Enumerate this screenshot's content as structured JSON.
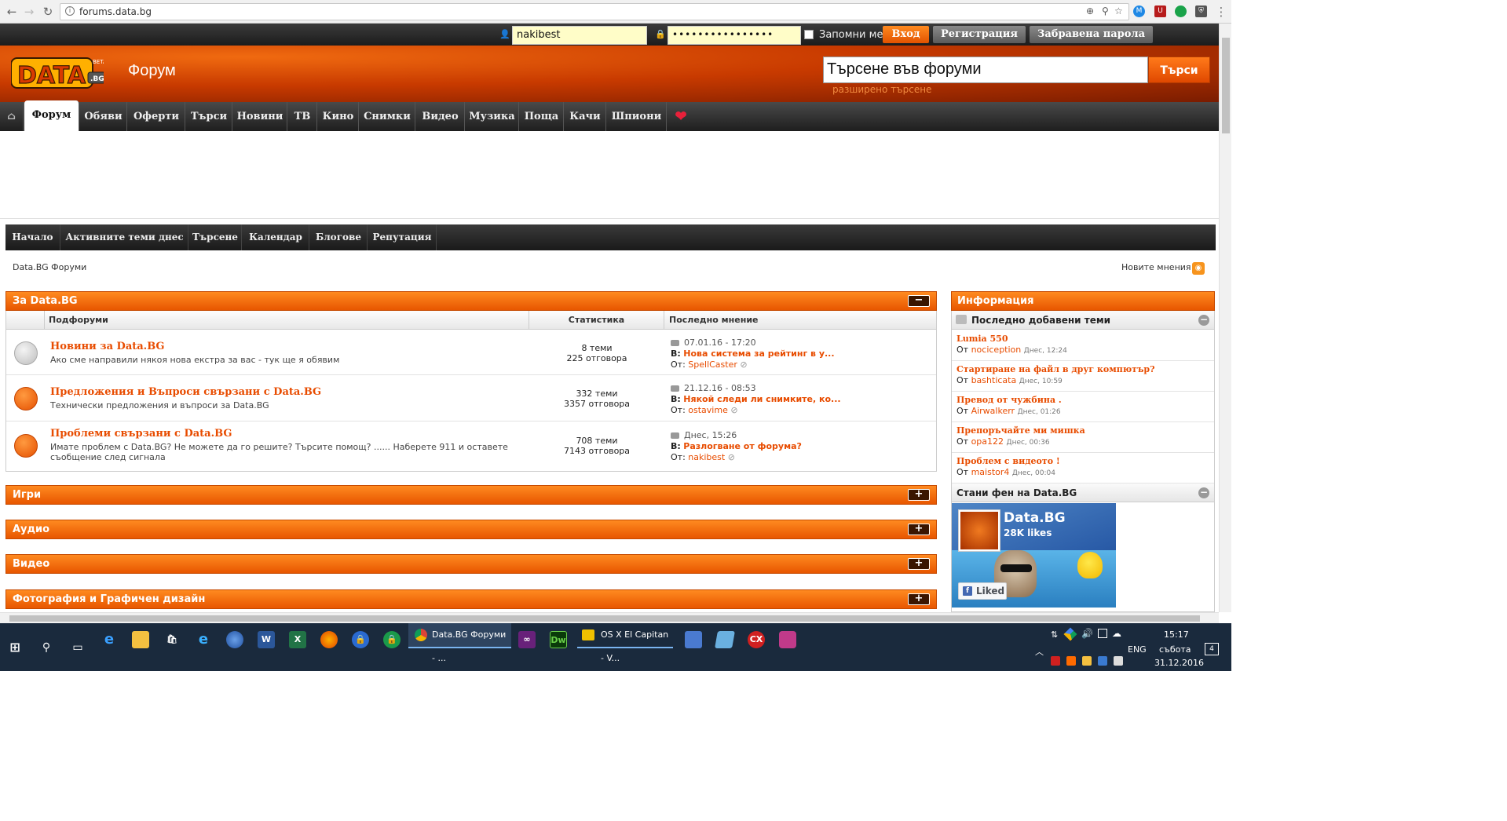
{
  "browser": {
    "url": "forums.data.bg"
  },
  "login": {
    "username": "nakibest",
    "password": "••••••••••••••••",
    "remember_label": "Запомни ме",
    "login_button": "Вход",
    "register_button": "Регистрация",
    "forgot_button": "Забравена парола"
  },
  "header": {
    "logo_text": "DATA",
    "logo_beta": "BETA",
    "logo_bg": ".BG",
    "title": "Форум",
    "search_value": "Търсене във форуми",
    "search_button": "Търси",
    "advanced_search": "разширено търсене"
  },
  "mainnav": {
    "items": [
      "Форум",
      "Обяви",
      "Оферти",
      "Търси",
      "Новини",
      "ТВ",
      "Кино",
      "Снимки",
      "Видео",
      "Музика",
      "Поща",
      "Качи",
      "Шпиони"
    ]
  },
  "subnav": {
    "items": [
      "Начало",
      "Активните теми днес",
      "Търсене",
      "Календар",
      "Блогове",
      "Репутация"
    ]
  },
  "breadcrumb": "Data.BG Форуми",
  "new_posts": "Новите мнения",
  "category": {
    "title": "За Data.BG",
    "col_subforums": "Подфоруми",
    "col_stats": "Статистика",
    "col_last": "Последно мнение",
    "forums": [
      {
        "title": "Новини за Data.BG",
        "desc": "Ако сме направили някоя нова екстра за вас - тук ще я обявим",
        "topics": "8 теми",
        "replies": "225 отговора",
        "date": "07.01.16 - 17:20",
        "prefix": "В:",
        "last_title": "Нова система за рейтинг в у...",
        "from": "От:",
        "user": "SpellCaster"
      },
      {
        "title": "Предложения и Въпроси свързани с Data.BG",
        "desc": "Технически предложения и въпроси за Data.BG",
        "topics": "332 теми",
        "replies": "3357 отговора",
        "date": "21.12.16 - 08:53",
        "prefix": "В:",
        "last_title": "Някой следи ли снимките, ко...",
        "from": "От:",
        "user": "ostavime"
      },
      {
        "title": "Проблеми свързани с Data.BG",
        "desc": "Имате проблем с Data.BG? Не можете да го решите? Търсите помощ? ...... Наберете 911 и оставете съобщение след сигнала",
        "topics": "708 теми",
        "replies": "7143 отговора",
        "date": "Днес, 15:26",
        "prefix": "В:",
        "last_title": "Разлогване от форума?",
        "from": "От:",
        "user": "nakibest"
      }
    ]
  },
  "collapsed_categories": [
    "Игри",
    "Аудио",
    "Видео",
    "Фотография и Графичен дизайн"
  ],
  "sidebar": {
    "title": "Информация",
    "latest_title": "Последно добавени теми",
    "latest": [
      {
        "title": "Lumia 550",
        "by": "От",
        "user": "nociception",
        "time": "Днес, 12:24"
      },
      {
        "title": "Стартиране на файл в друг компютър?",
        "by": "От",
        "user": "bashticata",
        "time": "Днес, 10:59"
      },
      {
        "title": "Превод от чужбина .",
        "by": "От",
        "user": "Airwalkerr",
        "time": "Днес, 01:26"
      },
      {
        "title": "Препоръчайте ми мишка",
        "by": "От",
        "user": "opa122",
        "time": "Днес, 00:36"
      },
      {
        "title": "Проблем с видеото !",
        "by": "От",
        "user": "maistor4",
        "time": "Днес, 00:04"
      }
    ],
    "fan_title": "Стани фен на Data.BG",
    "fb_name": "Data.BG",
    "fb_likes": "28K likes",
    "fb_button": "Liked"
  },
  "taskbar": {
    "active_window": "Data.BG Форуми - ...",
    "vm_window": "OS X El Capitan - V...",
    "lang": "ENG",
    "time": "15:17",
    "day": "събота",
    "date": "31.12.2016",
    "notifications": "4"
  },
  "colors": {
    "accent": "#e84c00",
    "header_dark": "#7a1c00",
    "nav_dark": "#1e1e1e",
    "taskbar": "#1a2a3d"
  }
}
